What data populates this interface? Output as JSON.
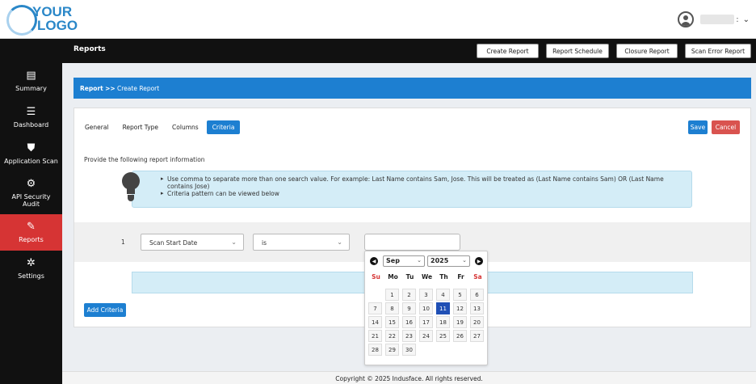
{
  "logo": {
    "line1": "YOUR",
    "line2": "LOGO"
  },
  "user": {
    "colon": ":",
    "chevron": "⌄"
  },
  "sidebar": {
    "items": [
      {
        "label": "Summary",
        "icon": "summary-icon",
        "glyph": "▤"
      },
      {
        "label": "Dashboard",
        "icon": "dashboard-icon",
        "glyph": "☰"
      },
      {
        "label": "Application Scan",
        "icon": "shield-icon",
        "glyph": "⛊"
      },
      {
        "label": "API Security Audit",
        "icon": "api-icon",
        "glyph": "⚙"
      },
      {
        "label": "Reports",
        "icon": "report-edit-icon",
        "glyph": "✎"
      },
      {
        "label": "Settings",
        "icon": "settings-gear-icon",
        "glyph": "✲"
      }
    ]
  },
  "titlebar": {
    "title": "Reports",
    "buttons": [
      "Create Report",
      "Report Schedule",
      "Closure Report",
      "Scan Error Report"
    ]
  },
  "breadcrumb": {
    "root": "Report",
    "sep": ">>",
    "current": "Create Report"
  },
  "tabs": [
    "General",
    "Report Type",
    "Columns",
    "Criteria"
  ],
  "actions": {
    "save": "Save",
    "cancel": "Cancel"
  },
  "info": {
    "title": "Provide the following report information",
    "line1": "Use comma to separate more than one search value. For example: Last Name contains Sam, Jose. This will be treated as (Last Name contains Sam) OR (Last Name contains Jose)",
    "line2": "Criteria pattern can be viewed below"
  },
  "criteria": {
    "row_number": "1",
    "field": "Scan Start Date",
    "operator": "is",
    "value": ""
  },
  "add_criteria": "Add Criteria",
  "calendar": {
    "month": "Sep",
    "year": "2025",
    "weekdays": [
      "Su",
      "Mo",
      "Tu",
      "We",
      "Th",
      "Fr",
      "Sa"
    ],
    "days": [
      "1",
      "2",
      "3",
      "4",
      "5",
      "6",
      "7",
      "8",
      "9",
      "10",
      "11",
      "12",
      "13",
      "14",
      "15",
      "16",
      "17",
      "18",
      "19",
      "20",
      "21",
      "22",
      "23",
      "24",
      "25",
      "26",
      "27",
      "28",
      "29",
      "30"
    ],
    "first_weekday": 1,
    "selected": "11"
  },
  "footer": "Copyright © 2025 Indusface. All rights reserved.",
  "colors": {
    "primary": "#1d7fd1",
    "danger": "#d9534f",
    "sidebar": "#111111",
    "active_sidebar": "#d63434"
  }
}
